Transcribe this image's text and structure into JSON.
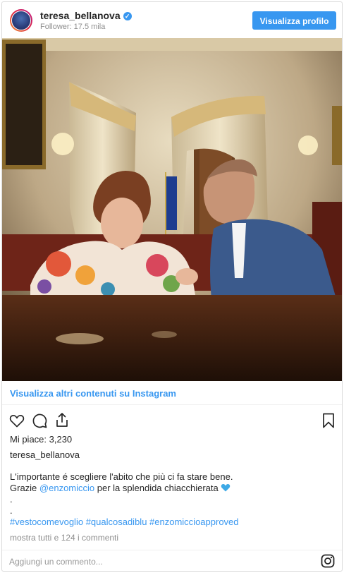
{
  "header": {
    "username": "teresa_bellanova",
    "followers": "Follower: 17.5 mila",
    "profile_button": "Visualizza profilo"
  },
  "post": {
    "more_link": "Visualizza altri contenuti su Instagram",
    "likes": "Mi piace: 3,230",
    "owner": "teresa_bellanova",
    "caption_line1": "L'importante é scegliere l'abito che più ci fa stare bene.",
    "caption_line2_prefix": "Grazie ",
    "caption_mention": "@enzomiccio",
    "caption_line2_suffix": " per la splendida chiacchierata ",
    "dot1": ".",
    "dot2": ".",
    "hashtags": [
      "#vestocomevoglio",
      "#qualcosadiblu",
      "#enzomiccioapproved"
    ],
    "view_comments": "mostra tutti e 124 i commenti"
  },
  "comment_box": {
    "placeholder": "Aggiungi un commento..."
  },
  "colors": {
    "accent": "#3897f0",
    "text": "#262626",
    "muted": "#8e8e8e"
  }
}
